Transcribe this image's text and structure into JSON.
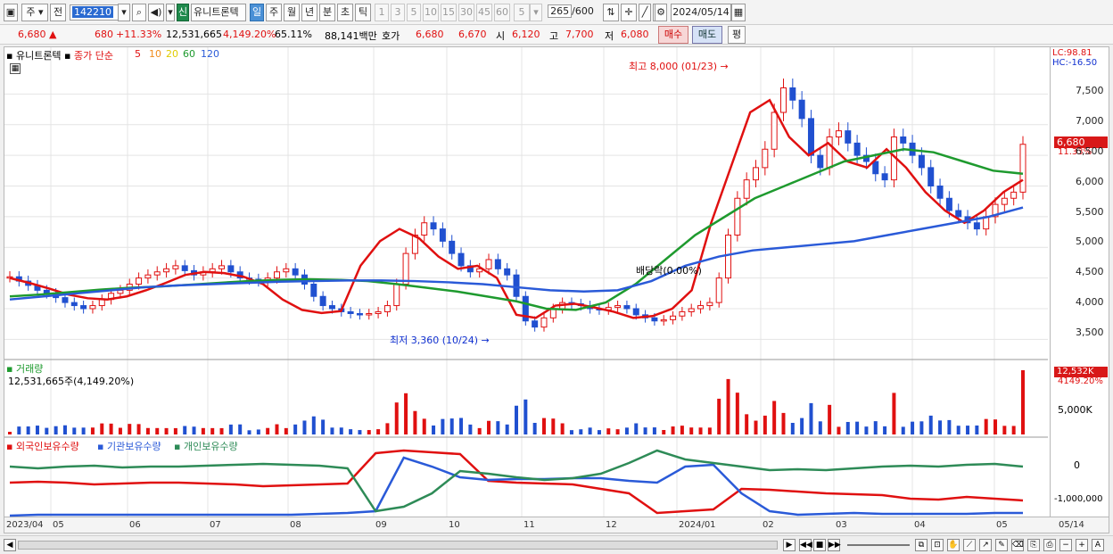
{
  "toolbar": {
    "period_type": "주",
    "prev_label": "전",
    "stock_code": "142210",
    "new_badge": "신",
    "stock_name": "유니트론텍",
    "periods": [
      "일",
      "주",
      "월",
      "년",
      "분",
      "초",
      "틱"
    ],
    "active_period": "일",
    "minute_options": [
      "1",
      "3",
      "5",
      "10",
      "15",
      "30",
      "45",
      "60"
    ],
    "interval_value": "5",
    "view_count": "265",
    "view_total": "/600",
    "date": "2024/05/14"
  },
  "quote": {
    "price": "6,680",
    "change": "680",
    "change_pct": "+11.33%",
    "volume": "12,531,665",
    "volume_ratio": "4,149.20%",
    "turnover": "65.11%",
    "amount": "88,141백만",
    "bid_label": "호가",
    "ask_price": "6,680",
    "bid_price": "6,670",
    "open_label": "시",
    "open": "6,120",
    "high_label": "고",
    "high": "7,700",
    "low_label": "저",
    "low": "6,080",
    "buy_button": "매수",
    "sell_button": "매도",
    "eval_button": "평"
  },
  "price_panel": {
    "stock_name": "유니트론텍",
    "ma_label": "종가 단순",
    "ma_periods": [
      "5",
      "10",
      "20",
      "60",
      "120"
    ],
    "ma_colors": [
      "#e01010",
      "#f08c1c",
      "#f5e400",
      "#1e9a2e",
      "#2a5ad8"
    ],
    "lc": "LC:98.81",
    "hc": "HC:-16.50",
    "current_price": "6,680",
    "current_pct": "11.33%",
    "high_note": "최고 8,000 (01/23)",
    "low_note": "최저 3,360 (10/24)",
    "dividend_note": "배당락(0.00%)",
    "y_ticks": [
      "7,500",
      "7,000",
      "6,500",
      "6,000",
      "5,500",
      "5,000",
      "4,500",
      "4,000",
      "3,500"
    ]
  },
  "volume_panel": {
    "title": "거래량",
    "detail": "12,531,665주(4,149.20%)",
    "last_volume": "12,532K",
    "last_pct": "4149.20%",
    "y_tick": "5,000K"
  },
  "holdings_panel": {
    "series": [
      "외국인보유수량",
      "기관보유수량",
      "개인보유수량"
    ],
    "colors": [
      "#e01010",
      "#2a5ad8",
      "#2e8b57"
    ],
    "y_ticks": [
      "0",
      "-1,000,000"
    ]
  },
  "x_axis": {
    "labels": [
      "2023/04",
      "05",
      "06",
      "07",
      "08",
      "09",
      "10",
      "11",
      "12",
      "2024/01",
      "02",
      "03",
      "04",
      "05",
      "05/14"
    ]
  },
  "chart_data": {
    "type": "candlestick",
    "x_range": [
      "2023/04",
      "2024/05/14"
    ],
    "ylim": [
      3200,
      8000
    ],
    "y_ticks": [
      3500,
      4000,
      4500,
      5000,
      5500,
      6000,
      6500,
      7000,
      7500
    ],
    "closes": [
      4520,
      4450,
      4380,
      4300,
      4250,
      4180,
      4100,
      4050,
      4000,
      4050,
      4150,
      4250,
      4300,
      4400,
      4500,
      4550,
      4600,
      4650,
      4700,
      4620,
      4550,
      4600,
      4650,
      4700,
      4600,
      4500,
      4480,
      4450,
      4500,
      4600,
      4650,
      4550,
      4400,
      4200,
      4050,
      4000,
      3950,
      3920,
      3900,
      3920,
      3950,
      4050,
      4400,
      4900,
      5200,
      5400,
      5300,
      5100,
      4900,
      4700,
      4600,
      4650,
      4800,
      4650,
      4550,
      4200,
      3800,
      3700,
      3850,
      4000,
      4100,
      4080,
      4050,
      4000,
      3980,
      4020,
      4050,
      4000,
      3900,
      3850,
      3800,
      3820,
      3880,
      3950,
      4000,
      4050,
      4100,
      4500,
      5200,
      5800,
      6100,
      6300,
      6600,
      7200,
      7600,
      7400,
      7100,
      6500,
      6300,
      6800,
      6900,
      6700,
      6500,
      6400,
      6200,
      6100,
      6800,
      6700,
      6500,
      6300,
      6000,
      5800,
      5600,
      5500,
      5400,
      5300,
      5500,
      5700,
      5800,
      5900,
      6680
    ],
    "ma": [
      {
        "period": 5,
        "values": [
          4500,
          4420,
          4330,
          4230,
          4170,
          4150,
          4200,
          4300,
          4420,
          4550,
          4600,
          4580,
          4520,
          4400,
          4150,
          3980,
          3930,
          3960,
          4700,
          5100,
          5300,
          5150,
          4850,
          4650,
          4700,
          4500,
          3900,
          3850,
          4050,
          4080,
          4020,
          3950,
          3850,
          3880,
          4000,
          4300,
          5400,
          6300,
          7200,
          7400,
          6800,
          6500,
          6700,
          6400,
          6300,
          6600,
          6300,
          5900,
          5600,
          5400,
          5600,
          5900,
          6100
        ]
      },
      {
        "period": 60,
        "values": [
          4200,
          4230,
          4270,
          4310,
          4340,
          4360,
          4390,
          4420,
          4450,
          4470,
          4480,
          4470,
          4450,
          4400,
          4340,
          4280,
          4200,
          4120,
          4000,
          3980,
          4100,
          4400,
          4800,
          5200,
          5500,
          5800,
          6000,
          6200,
          6400,
          6500,
          6600,
          6550,
          6400,
          6250,
          6200
        ]
      },
      {
        "period": 120,
        "values": [
          4150,
          4200,
          4250,
          4300,
          4350,
          4380,
          4400,
          4420,
          4440,
          4450,
          4460,
          4460,
          4450,
          4430,
          4400,
          4350,
          4300,
          4280,
          4300,
          4450,
          4700,
          4850,
          4950,
          5000,
          5050,
          5100,
          5200,
          5300,
          5400,
          5500,
          5650
        ]
      }
    ],
    "volume": {
      "last": "12,532K",
      "tick": "5,000K"
    },
    "annotations": [
      "최고 8,000 (01/23)",
      "최저 3,360 (10/24)",
      "배당락(0.00%)"
    ]
  }
}
